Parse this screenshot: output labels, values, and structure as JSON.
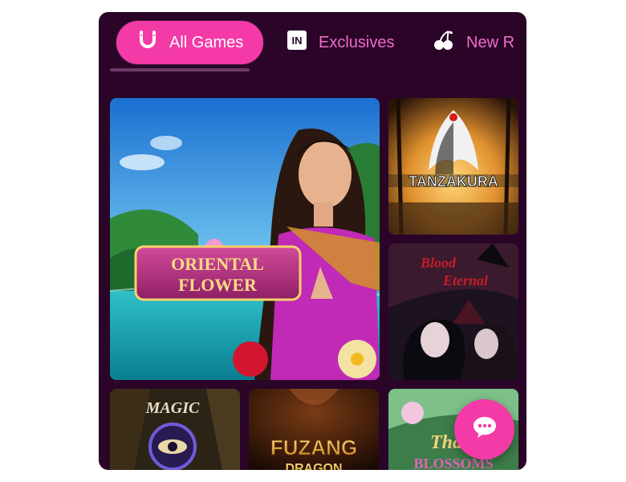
{
  "tabs": [
    {
      "label": "All Games",
      "icon": "horseshoe-icon",
      "active": true
    },
    {
      "label": "Exclusives",
      "icon": "in-badge-icon",
      "active": false
    },
    {
      "label": "New R",
      "icon": "cherries-icon",
      "active": false
    }
  ],
  "games": [
    {
      "title_line1": "ORIENTAL",
      "title_line2": "FLOWER"
    },
    {
      "title": "TANZAKURA"
    },
    {
      "title_line1": "Blood",
      "title_line2": "Eternal"
    },
    {
      "title_line1": "MAGIC"
    },
    {
      "title_line1": "FUZANG",
      "title_line2": "DRAGON"
    },
    {
      "title_line1": "Thai",
      "title_line2": "BLOSSOMS"
    }
  ],
  "chat": {
    "icon": "chat-bubble-icon"
  },
  "colors": {
    "accent": "#f43aa6",
    "panel": "#2a0528",
    "tab_text": "#f06cc8"
  }
}
